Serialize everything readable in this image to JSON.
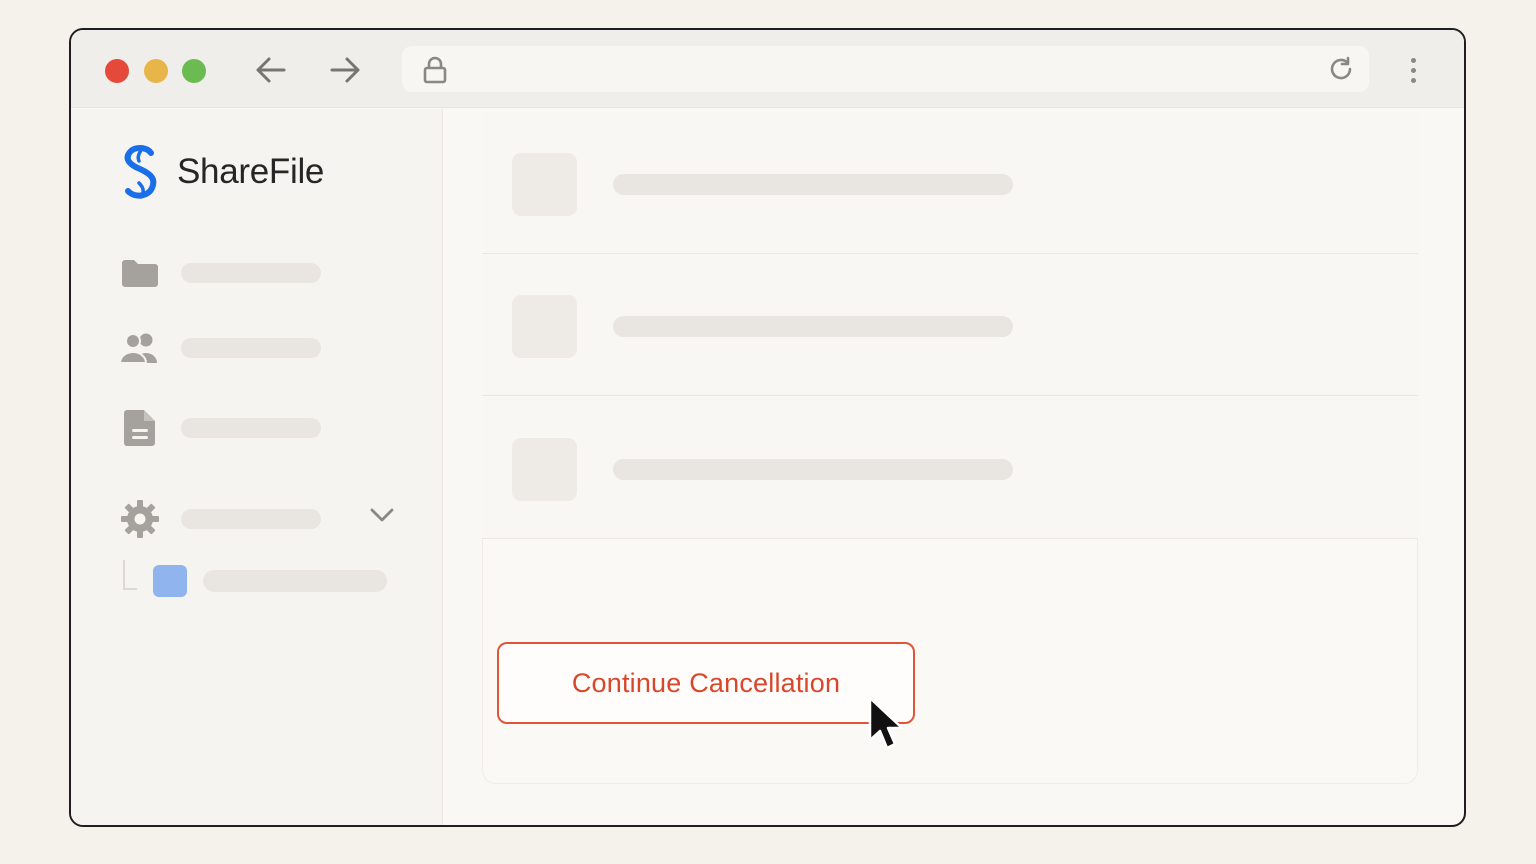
{
  "browser": {
    "traffic_lights": [
      "close",
      "minimize",
      "maximize"
    ],
    "icons": {
      "back": "arrow-left-icon",
      "forward": "arrow-right-icon",
      "lock": "lock-icon",
      "reload": "reload-icon",
      "menu": "kebab-menu-icon"
    }
  },
  "sidebar": {
    "brand": {
      "name": "ShareFile",
      "logo_color": "#1a6fe8"
    },
    "items": [
      {
        "icon": "folder-icon",
        "label": ""
      },
      {
        "icon": "users-icon",
        "label": ""
      },
      {
        "icon": "document-icon",
        "label": ""
      },
      {
        "icon": "gear-icon",
        "label": "",
        "expandable": true
      }
    ],
    "subitem": {
      "icon_color": "#8fb4ee",
      "label": ""
    }
  },
  "main": {
    "rows": [
      {
        "label": ""
      },
      {
        "label": ""
      },
      {
        "label": ""
      }
    ],
    "cancel_button": {
      "label": "Continue Cancellation",
      "color": "#d9472b"
    }
  }
}
